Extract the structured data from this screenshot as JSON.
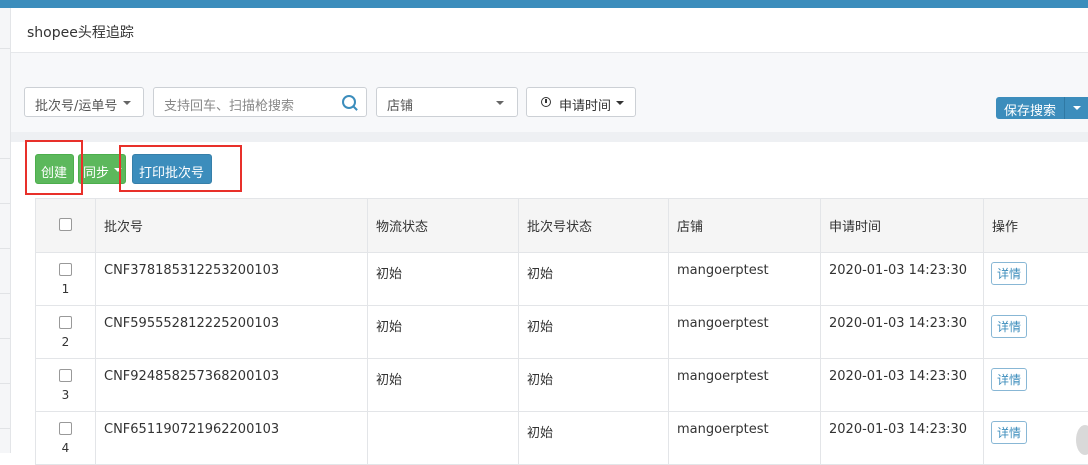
{
  "page": {
    "title": "shopee头程追踪"
  },
  "filters": {
    "batch_select": "批次号/运单号",
    "search_placeholder": "支持回车、扫描枪搜索",
    "shop_select": "店铺",
    "time_select": "申请时间",
    "save_search": "保存搜索"
  },
  "toolbar": {
    "create": "创建",
    "sync": "同步",
    "print_batch": "打印批次号"
  },
  "table": {
    "columns": [
      "批次号",
      "物流状态",
      "批次号状态",
      "店铺",
      "申请时间",
      "操作"
    ],
    "detail_label": "详情",
    "rows": [
      {
        "num": "1",
        "batch": "CNF378185312253200103",
        "logistics": "初始",
        "batch_status": "初始",
        "shop": "mangoerptest",
        "time": "2020-01-03 14:23:30"
      },
      {
        "num": "2",
        "batch": "CNF595552812225200103",
        "logistics": "初始",
        "batch_status": "初始",
        "shop": "mangoerptest",
        "time": "2020-01-03 14:23:30"
      },
      {
        "num": "3",
        "batch": "CNF924858257368200103",
        "logistics": "初始",
        "batch_status": "初始",
        "shop": "mangoerptest",
        "time": "2020-01-03 14:23:30"
      },
      {
        "num": "4",
        "batch": "CNF651190721962200103",
        "logistics": "",
        "batch_status": "初始",
        "shop": "mangoerptest",
        "time": "2020-01-03 14:23:30"
      }
    ]
  },
  "colors": {
    "primary": "#3c8dbc",
    "success": "#5cb85c",
    "highlight": "#e8302a"
  }
}
